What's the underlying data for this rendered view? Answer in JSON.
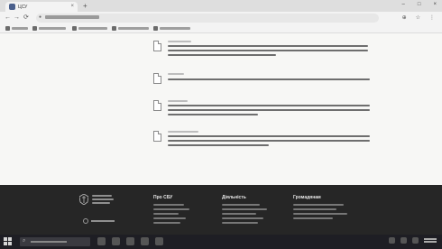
{
  "browser": {
    "tab_title": "ЦСУ",
    "tab_close": "×",
    "new_tab": "+",
    "window_controls": [
      "–",
      "□",
      "×"
    ],
    "nav": {
      "back": "←",
      "forward": "→",
      "reload": "⟳"
    },
    "toolbar_icons": [
      "⊕",
      "☆",
      "⋮"
    ]
  },
  "content": {
    "documents_count": 4
  },
  "footer": {
    "columns": [
      {
        "title": "Про СБУ",
        "link_count": 6
      },
      {
        "title": "Діяльність",
        "link_count": 6
      },
      {
        "title": "Громадянам",
        "link_count": 5
      }
    ]
  },
  "taskbar": {
    "search_glyph": "⌕"
  },
  "colors": {
    "footer_bg": "#262626",
    "page_bg": "#f7f7f5",
    "taskbar_bg": "#1e1e24"
  }
}
